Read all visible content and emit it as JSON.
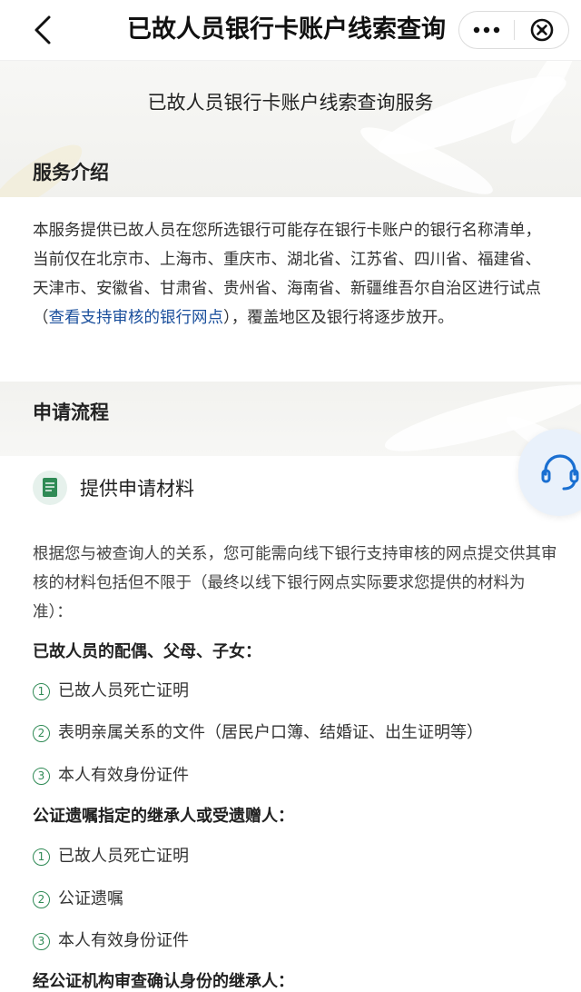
{
  "nav": {
    "title": "已故人员银行卡账户线索查询",
    "back_icon": "chevron-left-icon",
    "more_icon": "more-dots-icon",
    "close_icon": "close-circle-icon"
  },
  "banner": {
    "title": "已故人员银行卡账户线索查询服务"
  },
  "intro": {
    "heading": "服务介绍",
    "text_before_link": "本服务提供已故人员在您所选银行可能存在银行卡账户的银行名称清单，当前仅在北京市、上海市、重庆市、湖北省、江苏省、四川省、福建省、天津市、安徽省、甘肃省、贵州省、海南省、新疆维吾尔自治区进行试点（",
    "link": "查看支持审核的银行网点",
    "text_after_link": "），覆盖地区及银行将逐步放开。"
  },
  "process": {
    "heading": "申请流程",
    "step1_title": "提供申请材料",
    "step1_desc": "根据您与被查询人的关系，您可能需向线下银行支持审核的网点提交供其审核的材料包括但不限于（最终以线下银行网点实际要求您提供的材料为准）：",
    "groups": [
      {
        "title": "已故人员的配偶、父母、子女：",
        "items": [
          {
            "num": "1",
            "text": "已故人员死亡证明"
          },
          {
            "num": "2",
            "text": "表明亲属关系的文件（居民户口簿、结婚证、出生证明等）"
          },
          {
            "num": "3",
            "text": "本人有效身份证件"
          }
        ]
      },
      {
        "title": "公证遗嘱指定的继承人或受遗赠人：",
        "items": [
          {
            "num": "1",
            "text": "已故人员死亡证明"
          },
          {
            "num": "2",
            "text": "公证遗嘱"
          },
          {
            "num": "3",
            "text": "本人有效身份证件"
          }
        ]
      },
      {
        "title": "经公证机构审查确认身份的继承人："
      }
    ]
  },
  "colors": {
    "link": "#1a4f9c",
    "accent_green": "#2f8a55",
    "customer_service": "#1a6fd1"
  },
  "icons": {
    "customer_service": "headset-icon",
    "step": "document-icon"
  }
}
